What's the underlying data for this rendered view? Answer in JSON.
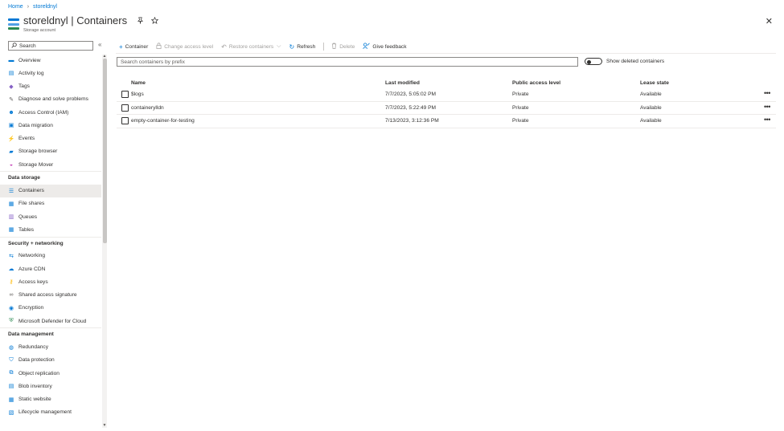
{
  "breadcrumb": {
    "home": "Home",
    "separator": "›",
    "resource": "storeldnyl"
  },
  "header": {
    "title": "storeldnyl | Containers",
    "subtitle": "Storage account",
    "pin_icon": "pin-icon",
    "star_icon": "star-icon",
    "close_glyph": "✕"
  },
  "sidebar": {
    "search_placeholder": "Search",
    "collapse_glyph": "«",
    "items": [
      {
        "label": "Overview",
        "icon": "overview-icon",
        "glyph": "▬",
        "color": "#0078d4"
      },
      {
        "label": "Activity log",
        "icon": "activity-log-icon",
        "glyph": "▤",
        "color": "#0078d4"
      },
      {
        "label": "Tags",
        "icon": "tag-icon",
        "glyph": "◆",
        "color": "#8661c5"
      },
      {
        "label": "Diagnose and solve problems",
        "icon": "wrench-icon",
        "glyph": "✎",
        "color": "#605e5c"
      },
      {
        "label": "Access Control (IAM)",
        "icon": "iam-icon",
        "glyph": "☻",
        "color": "#0078d4"
      },
      {
        "label": "Data migration",
        "icon": "data-migration-icon",
        "glyph": "▣",
        "color": "#0078d4"
      },
      {
        "label": "Events",
        "icon": "lightning-icon",
        "glyph": "⚡",
        "color": "#ffb900"
      },
      {
        "label": "Storage browser",
        "icon": "storage-browser-icon",
        "glyph": "▰",
        "color": "#0078d4"
      },
      {
        "label": "Storage Mover",
        "icon": "storage-mover-icon",
        "glyph": "◒",
        "color": "#c239b3"
      }
    ],
    "sections": [
      {
        "title": "Data storage",
        "items": [
          {
            "label": "Containers",
            "icon": "containers-icon",
            "glyph": "☰",
            "color": "#0078d4",
            "active": true
          },
          {
            "label": "File shares",
            "icon": "file-shares-icon",
            "glyph": "▦",
            "color": "#0078d4"
          },
          {
            "label": "Queues",
            "icon": "queues-icon",
            "glyph": "▥",
            "color": "#8661c5"
          },
          {
            "label": "Tables",
            "icon": "tables-icon",
            "glyph": "▦",
            "color": "#0078d4"
          }
        ]
      },
      {
        "title": "Security + networking",
        "items": [
          {
            "label": "Networking",
            "icon": "networking-icon",
            "glyph": "⇆",
            "color": "#0078d4"
          },
          {
            "label": "Azure CDN",
            "icon": "cloud-icon",
            "glyph": "☁",
            "color": "#0078d4"
          },
          {
            "label": "Access keys",
            "icon": "key-icon",
            "glyph": "⚷",
            "color": "#ffb900"
          },
          {
            "label": "Shared access signature",
            "icon": "link-icon",
            "glyph": "∞",
            "color": "#605e5c"
          },
          {
            "label": "Encryption",
            "icon": "encryption-icon",
            "glyph": "◉",
            "color": "#0078d4"
          },
          {
            "label": "Microsoft Defender for Cloud",
            "icon": "shield-icon",
            "glyph": "⛨",
            "color": "#2a8a52"
          }
        ]
      },
      {
        "title": "Data management",
        "items": [
          {
            "label": "Redundancy",
            "icon": "redundancy-icon",
            "glyph": "◍",
            "color": "#0078d4"
          },
          {
            "label": "Data protection",
            "icon": "data-protection-icon",
            "glyph": "⛉",
            "color": "#0078d4"
          },
          {
            "label": "Object replication",
            "icon": "object-replication-icon",
            "glyph": "⧉",
            "color": "#0078d4"
          },
          {
            "label": "Blob inventory",
            "icon": "blob-inventory-icon",
            "glyph": "▤",
            "color": "#0078d4"
          },
          {
            "label": "Static website",
            "icon": "static-website-icon",
            "glyph": "▦",
            "color": "#0078d4"
          },
          {
            "label": "Lifecycle management",
            "icon": "lifecycle-icon",
            "glyph": "▧",
            "color": "#0078d4"
          }
        ]
      }
    ]
  },
  "toolbar": {
    "add_container": "Container",
    "change_access": "Change access level",
    "restore": "Restore containers",
    "refresh": "Refresh",
    "delete": "Delete",
    "feedback": "Give feedback"
  },
  "filter": {
    "placeholder": "Search containers by prefix",
    "toggle_label": "Show deleted containers",
    "toggle_on": false
  },
  "table": {
    "columns": [
      "Name",
      "Last modified",
      "Public access level",
      "Lease state"
    ],
    "rows": [
      {
        "name": "$logs",
        "modified": "7/7/2023, 5:05:02 PM",
        "access": "Private",
        "lease": "Available"
      },
      {
        "name": "containerylldn",
        "modified": "7/7/2023, 5:22:49 PM",
        "access": "Private",
        "lease": "Available"
      },
      {
        "name": "empty-container-for-testing",
        "modified": "7/13/2023, 3:12:36 PM",
        "access": "Private",
        "lease": "Available"
      }
    ],
    "more_glyph": "•••"
  }
}
